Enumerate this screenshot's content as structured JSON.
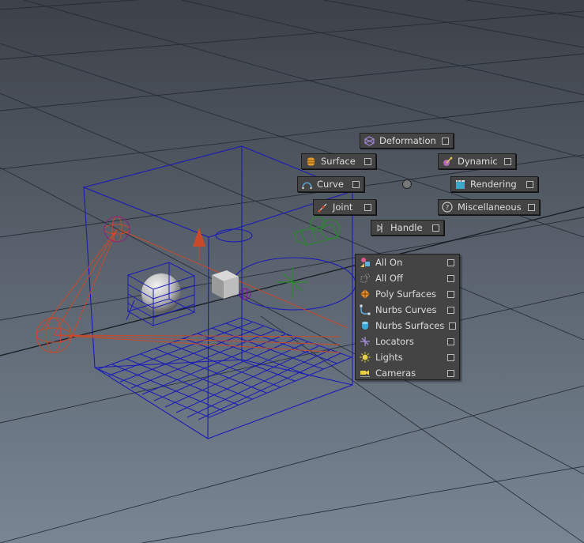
{
  "radial": {
    "deformation": {
      "label": "Deformation",
      "icon": "deformation-icon"
    },
    "surface": {
      "label": "Surface",
      "icon": "surface-icon"
    },
    "dynamic": {
      "label": "Dynamic",
      "icon": "dynamic-icon"
    },
    "curve": {
      "label": "Curve",
      "icon": "curve-icon"
    },
    "rendering": {
      "label": "Rendering",
      "icon": "rendering-icon"
    },
    "joint": {
      "label": "Joint",
      "icon": "joint-icon"
    },
    "miscellaneous": {
      "label": "Miscellaneous",
      "icon": "question-icon"
    },
    "handle": {
      "label": "Handle",
      "icon": "handle-icon"
    }
  },
  "menu": {
    "items": [
      {
        "label": "All On",
        "icon": "all-on-icon"
      },
      {
        "label": "All Off",
        "icon": "all-off-icon"
      },
      {
        "label": "Poly Surfaces",
        "icon": "poly-surfaces-icon"
      },
      {
        "label": "Nurbs Curves",
        "icon": "nurbs-curves-icon"
      },
      {
        "label": "Nurbs Surfaces",
        "icon": "nurbs-surfaces-icon"
      },
      {
        "label": "Locators",
        "icon": "locators-icon"
      },
      {
        "label": "Lights",
        "icon": "lights-icon"
      },
      {
        "label": "Cameras",
        "icon": "cameras-icon"
      }
    ]
  },
  "colors": {
    "viewport_top": "#3d4149",
    "viewport_bottom": "#778593",
    "grid": "#222b33",
    "selection": "#1a1ab0",
    "joint": "#c9492a",
    "locator": "#2a8a2a"
  }
}
